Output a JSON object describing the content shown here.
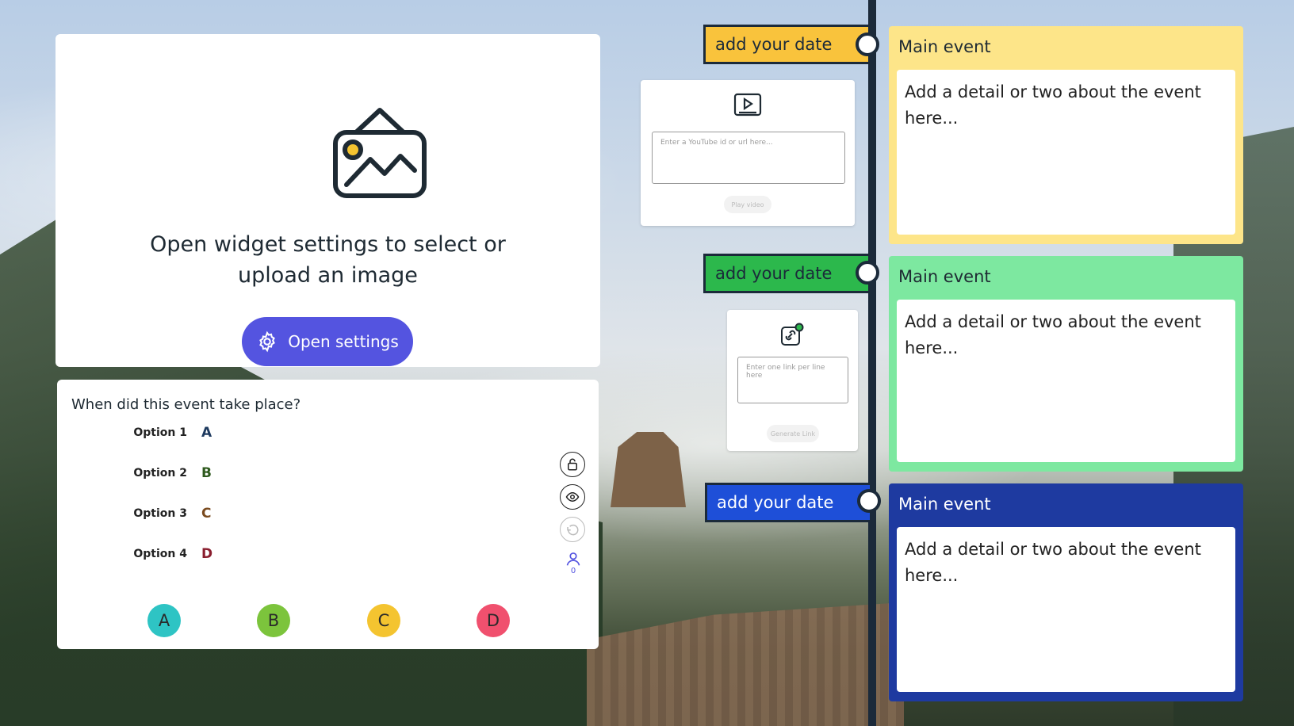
{
  "image_widget": {
    "prompt": "Open widget settings to select or upload an image",
    "button_label": "Open settings"
  },
  "quiz": {
    "question": "When did this event take place?",
    "options": [
      {
        "label": "Option 1",
        "letter": "A",
        "color": "#1e3a5f"
      },
      {
        "label": "Option 2",
        "letter": "B",
        "color": "#2e5a1e"
      },
      {
        "label": "Option 3",
        "letter": "C",
        "color": "#7a4a1e"
      },
      {
        "label": "Option 4",
        "letter": "D",
        "color": "#8a1e2e"
      }
    ],
    "answers": [
      {
        "letter": "A",
        "color": "#2ec4c4"
      },
      {
        "letter": "B",
        "color": "#7cc43c"
      },
      {
        "letter": "C",
        "color": "#f4c430"
      },
      {
        "letter": "D",
        "color": "#f0506e"
      }
    ],
    "responses": "0"
  },
  "timeline": {
    "events": [
      {
        "date": "add your date",
        "title": "Main event",
        "detail": "Add a detail or two about the event here...",
        "color": "#f9c33c",
        "card_color": "#fde589",
        "title_color": "#1e2a33"
      },
      {
        "date": "add your date",
        "title": "Main event",
        "detail": "Add a detail or two about the event here...",
        "color": "#2cb84c",
        "card_color": "#7de8a0",
        "title_color": "#1e2a33"
      },
      {
        "date": "add your date",
        "title": "Main event",
        "detail": "Add a detail or two about the event here...",
        "color": "#1e4fd8",
        "card_color": "#1e3aa0",
        "title_color": "#ffffff"
      }
    ]
  },
  "youtube_widget": {
    "placeholder": "Enter a YouTube id or url here...",
    "button_label": "Play video"
  },
  "link_widget": {
    "placeholder": "Enter one link per line here",
    "button_label": "Generate Link"
  }
}
